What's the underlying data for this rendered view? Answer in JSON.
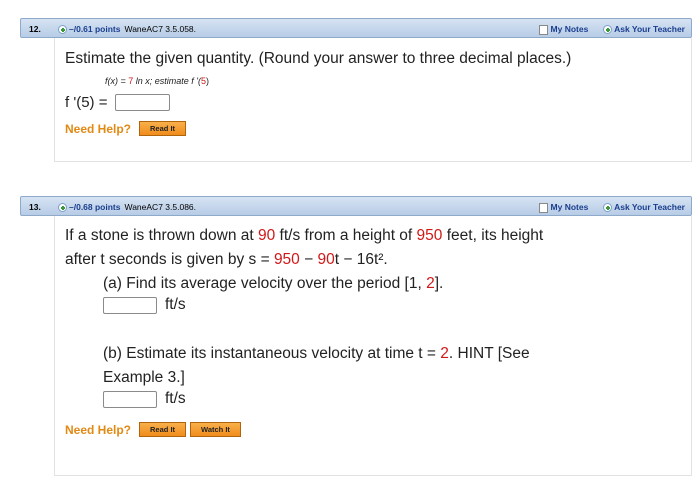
{
  "q12": {
    "number": "12.",
    "points": "–/0.61 points",
    "source": "WaneAC7 3.5.058.",
    "my_notes": "My Notes",
    "ask_teacher": "Ask Your Teacher",
    "prompt": "Estimate the given quantity. (Round your answer to three decimal places.)",
    "given_prefix": "f(x) = ",
    "given_coef": "7",
    "given_mid": " ln x;  estimate f '(",
    "given_arg": "5",
    "given_end": ")",
    "answer_label": "f '(5) =",
    "need_help": "Need Help?",
    "read_it": "Read It"
  },
  "q13": {
    "number": "13.",
    "points": "–/0.68 points",
    "source": "WaneAC7 3.5.086.",
    "my_notes": "My Notes",
    "ask_teacher": "Ask Your Teacher",
    "line1_a": "If a stone is thrown down at ",
    "speed": "90",
    "line1_b": " ft/s from a height of ",
    "height": "950",
    "line1_c": " feet, its height",
    "line2_a": "after t seconds is given by s = ",
    "s0": "950",
    "line2_b": " − ",
    "v0": "90",
    "line2_c": "t − 16t².",
    "part_a_a": "(a) Find its average velocity over the period [1, ",
    "part_a_end": "2",
    "part_a_b": "].",
    "unit_a": "ft/s",
    "part_b_a": "(b) Estimate its instantaneous velocity at time t = ",
    "part_b_t": "2",
    "part_b_b": ". HINT [See",
    "part_b_line2": "Example 3.]",
    "unit_b": "ft/s",
    "need_help": "Need Help?",
    "read_it": "Read It",
    "watch_it": "Watch It"
  },
  "colors": {
    "accent": "#1a3e8e",
    "value_red": "#d01818",
    "help_orange": "#e08a14",
    "header_blue": "#c6d8ee"
  }
}
